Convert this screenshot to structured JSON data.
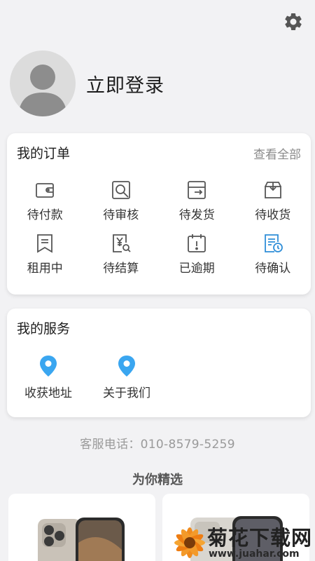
{
  "header": {
    "settings_icon": "gear-icon"
  },
  "profile": {
    "login_label": "立即登录",
    "avatar_icon": "default-avatar"
  },
  "orders": {
    "title": "我的订单",
    "view_all": "查看全部",
    "rows": [
      [
        {
          "label": "待付款",
          "icon": "wallet-icon"
        },
        {
          "label": "待审核",
          "icon": "review-icon"
        },
        {
          "label": "待发货",
          "icon": "ship-icon"
        },
        {
          "label": "待收货",
          "icon": "receive-box-icon"
        }
      ],
      [
        {
          "label": "租用中",
          "icon": "bookmark-icon"
        },
        {
          "label": "待结算",
          "icon": "settle-icon"
        },
        {
          "label": "已逾期",
          "icon": "calendar-alert-icon"
        },
        {
          "label": "待确认",
          "icon": "confirm-doc-icon"
        }
      ]
    ]
  },
  "services": {
    "title": "我的服务",
    "items": [
      {
        "label": "收获地址",
        "icon": "location-pin-icon"
      },
      {
        "label": "关于我们",
        "icon": "location-pin-icon"
      }
    ]
  },
  "hotline": {
    "label": "客服电话：",
    "number": "010-8579-5259"
  },
  "recommend": {
    "title": "为你精选"
  },
  "watermark": {
    "title": "菊花下载网",
    "url": "www.juahar.com"
  },
  "colors": {
    "accent_blue": "#2f8ed8",
    "pin_blue": "#3aa6f0",
    "icon_gray": "#555555"
  }
}
